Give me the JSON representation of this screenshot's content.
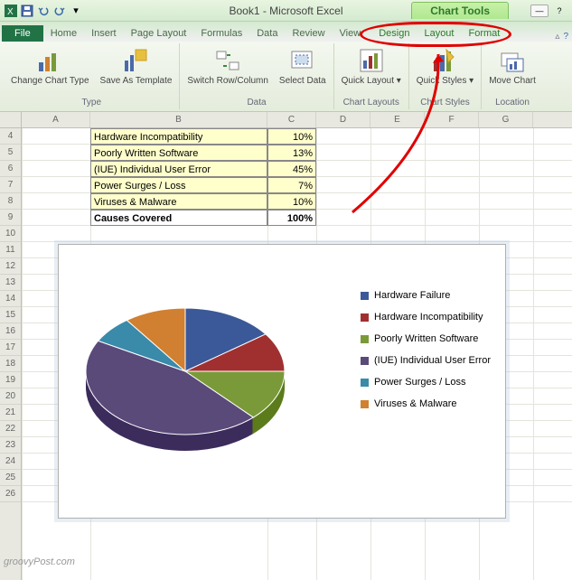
{
  "title": "Book1 - Microsoft Excel",
  "chart_tools_title": "Chart Tools",
  "tabs": {
    "file": "File",
    "list": [
      "Home",
      "Insert",
      "Page Layout",
      "Formulas",
      "Data",
      "Review",
      "View"
    ],
    "chart_tools": [
      "Design",
      "Layout",
      "Format"
    ]
  },
  "ribbon": {
    "type": {
      "label": "Type",
      "buttons": [
        "Change Chart Type",
        "Save As Template"
      ]
    },
    "data": {
      "label": "Data",
      "buttons": [
        "Switch Row/Column",
        "Select Data"
      ]
    },
    "layouts": {
      "label": "Chart Layouts",
      "buttons": [
        "Quick Layout"
      ]
    },
    "styles": {
      "label": "Chart Styles",
      "buttons": [
        "Quick Styles"
      ]
    },
    "location": {
      "label": "Location",
      "buttons": [
        "Move Chart"
      ]
    }
  },
  "columns": [
    "A",
    "B",
    "C",
    "D",
    "E",
    "F",
    "G"
  ],
  "rows": [
    "4",
    "5",
    "6",
    "7",
    "8",
    "9",
    "10",
    "11",
    "12",
    "13",
    "14",
    "15",
    "16",
    "17",
    "18",
    "19",
    "20",
    "21",
    "22",
    "23",
    "24",
    "25",
    "26"
  ],
  "table": {
    "rows": [
      {
        "label": "Hardware Incompatibility",
        "value": "10%"
      },
      {
        "label": "Poorly Written Software",
        "value": "13%"
      },
      {
        "label": "(IUE) Individual User Error",
        "value": "45%"
      },
      {
        "label": "Power Surges / Loss",
        "value": "7%"
      },
      {
        "label": "Viruses & Malware",
        "value": "10%"
      }
    ],
    "total": {
      "label": "Causes Covered",
      "value": "100%"
    }
  },
  "chart_data": {
    "type": "pie",
    "title": "",
    "series": [
      {
        "name": "Hardware Failure",
        "value": 15,
        "color": "#3b5998"
      },
      {
        "name": "Hardware Incompatibility",
        "value": 10,
        "color": "#a03030"
      },
      {
        "name": "Poorly Written Software",
        "value": 13,
        "color": "#7a9a3a"
      },
      {
        "name": "(IUE) Individual User Error",
        "value": 45,
        "color": "#5a4a7a"
      },
      {
        "name": "Power Surges / Loss",
        "value": 7,
        "color": "#3a8aaa"
      },
      {
        "name": "Viruses & Malware",
        "value": 10,
        "color": "#d08030"
      }
    ]
  },
  "watermark": "groovyPost.com"
}
